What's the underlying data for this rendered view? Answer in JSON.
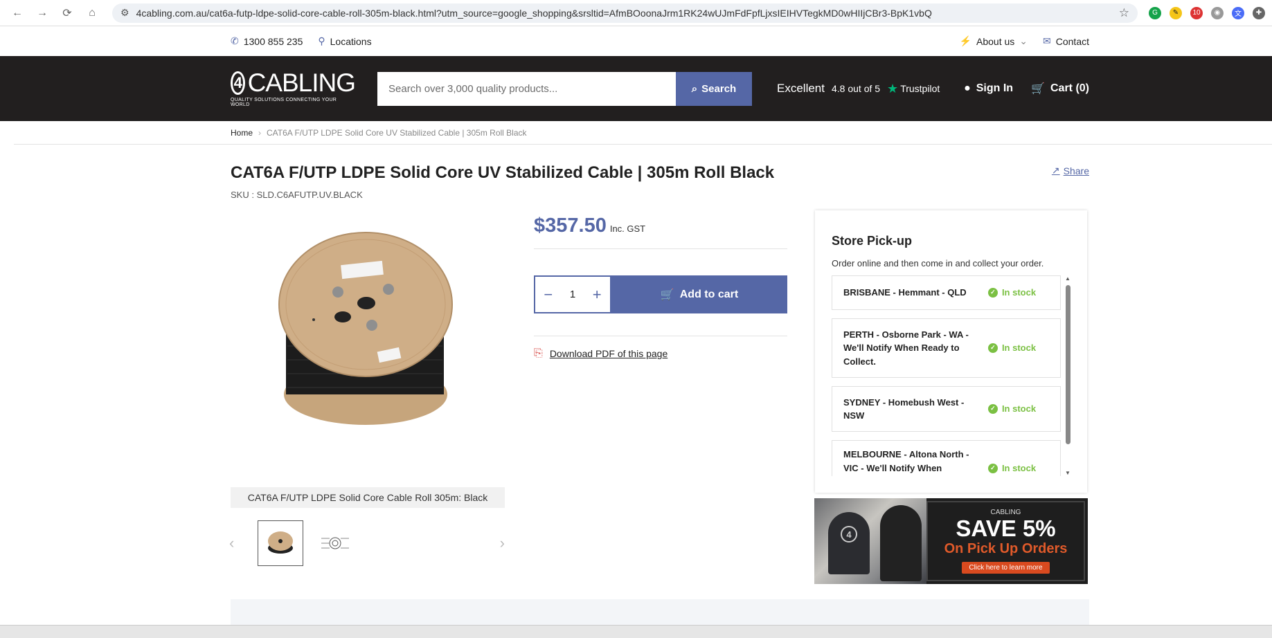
{
  "browser": {
    "url": "4cabling.com.au/cat6a-futp-ldpe-solid-core-cable-roll-305m-black.html?utm_source=google_shopping&srsltid=AfmBOoonaJrm1RK24wUJmFdFpfLjxsIEIHVTegkMD0wHIIjCBr3-BpK1vbQ",
    "ext_badge": "10"
  },
  "topbar": {
    "phone": "1300 855 235",
    "locations": "Locations",
    "about": "About us",
    "contact": "Contact"
  },
  "header": {
    "logo_text": "CABLING",
    "logo_tag": "QUALITY SOLUTIONS CONNECTING YOUR WORLD",
    "search_placeholder": "Search over 3,000 quality products...",
    "search_button": "Search",
    "trust_rating": "Excellent",
    "trust_score": "4.8 out of 5",
    "trust_brand": "Trustpilot",
    "sign_in": "Sign In",
    "cart": "Cart (0)"
  },
  "breadcrumb": {
    "home": "Home",
    "current": "CAT6A F/UTP LDPE Solid Core UV Stabilized Cable | 305m Roll Black"
  },
  "product": {
    "title": "CAT6A F/UTP LDPE Solid Core UV Stabilized Cable | 305m Roll Black",
    "sku": "SKU : SLD.C6AFUTP.UV.BLACK",
    "share": "Share",
    "price": "$357.50",
    "price_note": "Inc. GST",
    "qty": "1",
    "add_to_cart": "Add to cart",
    "download_pdf": "Download PDF of this page",
    "image_caption": "CAT6A F/UTP LDPE Solid Core Cable Roll 305m: Black"
  },
  "pickup": {
    "title": "Store Pick-up",
    "desc": "Order online and then come in and collect your order.",
    "stores": [
      {
        "name": "BRISBANE - Hemmant - QLD",
        "status": "In stock"
      },
      {
        "name": "PERTH - Osborne Park - WA - We'll Notify When Ready to Collect.",
        "status": "In stock"
      },
      {
        "name": "SYDNEY - Homebush West - NSW",
        "status": "In stock"
      },
      {
        "name": "MELBOURNE - Altona North - VIC - We'll Notify When",
        "status": "In stock"
      }
    ]
  },
  "banner": {
    "brand": "CABLING",
    "headline": "SAVE 5%",
    "sub": "On Pick Up Orders",
    "cta": "Click here to learn more"
  },
  "colors": {
    "accent": "#5567a6",
    "header_bg": "#221f1f",
    "in_stock": "#7bc043",
    "trustpilot": "#00b67a"
  }
}
